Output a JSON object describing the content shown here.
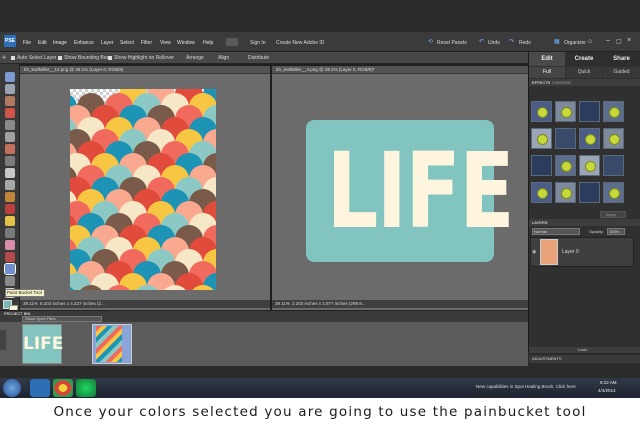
{
  "menu": {
    "items": [
      "File",
      "Edit",
      "Image",
      "Enhance",
      "Layer",
      "Select",
      "Filter",
      "View",
      "Window",
      "Help"
    ],
    "sign_in": "Sign In",
    "create_id": "Create New Adobe ID",
    "reset_panels": "Reset Panels",
    "undo": "Undo",
    "redo": "Redo",
    "organizer": "Organizer"
  },
  "options_bar": {
    "auto_select": "Auto Select Layer",
    "bounding_box": "Show Bounding Box",
    "highlight": "Show Highlight on Rollover",
    "arrange": "Arrange",
    "align": "Align",
    "distribute": "Distribute"
  },
  "documents": [
    {
      "tab": "bh_leafMiller__12.png @ 39.1% (Layer 0, RGB/8)",
      "zoom": "39.11%",
      "info": "5.203 inches x 4.227 inches (2..."
    },
    {
      "tab": "bh_leafMiller__4.png @ 39.1% (Layer 0, RGB/8)*",
      "zoom": "39.11%",
      "info": "3.203 inches x 2.977 inches (299.9..."
    }
  ],
  "life_text": "LIFE",
  "tool_tooltip": "Paint Bucket Tool",
  "right_panel": {
    "tabs": [
      "Edit",
      "Create",
      "Share"
    ],
    "subtabs": [
      "Full",
      "Quick",
      "Guided"
    ],
    "effects_label": "EFFECTS",
    "content_label": "CONTENT",
    "apply_label": "Apply",
    "layers_label": "LAYERS",
    "blend_mode": "Normal",
    "opacity_label": "Opacity:",
    "opacity_value": "100%",
    "layer_name": "Layer 0",
    "lock_label": "Lock:",
    "adjustments_label": "ADJUSTMENTS"
  },
  "project_bin": {
    "label": "PROJECT BIN",
    "dropdown": "Show Open Files",
    "thumb_text": "LIFE"
  },
  "taskbar": {
    "notice": "New capabilities in Spot Healing Brush. Click here",
    "time": "8:22 AM",
    "date": "4/4/2013"
  },
  "caption": "Once your colors selected you are going to use the painbucket tool",
  "colors": {
    "scales": [
      "#f06b5e",
      "#f7c744",
      "#1d93b5",
      "#8dc9c4",
      "#f9a98f",
      "#7a5a49",
      "#f6e8c6",
      "#e14b3b"
    ],
    "life_bg": "#82c4bf",
    "life_fg": "#fdf5dd"
  }
}
